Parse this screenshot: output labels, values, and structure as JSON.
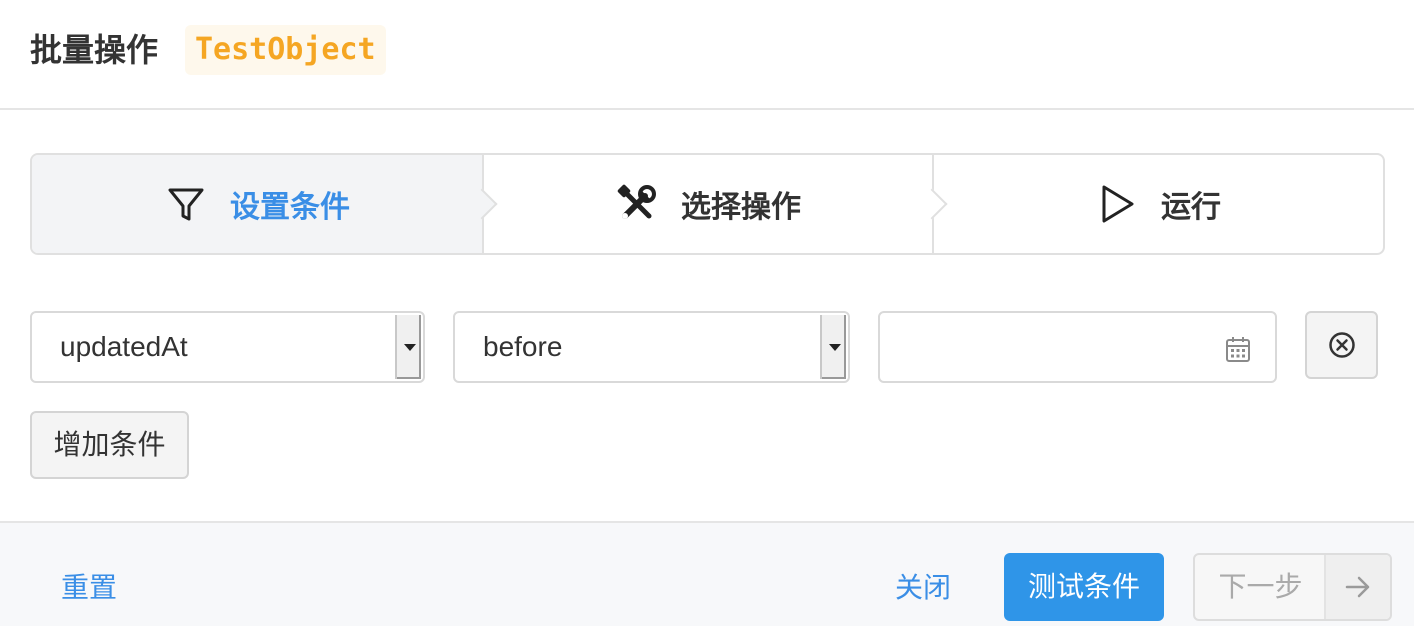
{
  "header": {
    "title": "批量操作",
    "object_name": "TestObject"
  },
  "steps": [
    {
      "label": "设置条件",
      "icon": "filter-icon",
      "active": true
    },
    {
      "label": "选择操作",
      "icon": "tools-icon",
      "active": false
    },
    {
      "label": "运行",
      "icon": "play-icon",
      "active": false
    }
  ],
  "condition": {
    "field_value": "updatedAt",
    "operator_value": "before",
    "date_value": "",
    "date_icon": "calendar-icon",
    "remove_icon": "close-circle-icon"
  },
  "add_condition_label": "增加条件",
  "footer": {
    "reset_label": "重置",
    "close_label": "关闭",
    "test_label": "测试条件",
    "next_label": "下一步",
    "next_icon": "arrow-right-icon"
  },
  "colors": {
    "accent": "#3a8ee6",
    "primary_button": "#2f95e8",
    "badge_text": "#f5a623",
    "badge_bg": "#fef8ec"
  }
}
